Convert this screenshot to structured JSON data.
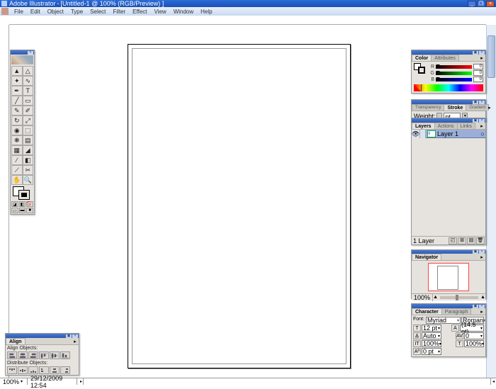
{
  "titlebar": {
    "app": "Adobe Illustrator",
    "doc": "[Untitled-1 @ 100% (RGB/Preview) ]"
  },
  "menu": [
    "File",
    "Edit",
    "Object",
    "Type",
    "Select",
    "Filter",
    "Effect",
    "View",
    "Window",
    "Help"
  ],
  "status": {
    "zoom": "100%",
    "datetime": "29/12/2009  12:54"
  },
  "color": {
    "tab_color": "Color",
    "tab_attr": "Attributes",
    "r": "0",
    "g": "0",
    "b": "0"
  },
  "stroke": {
    "tab_trans": "Transparency",
    "tab_stroke": "Stroke",
    "tab_grad": "Gradient",
    "label": "Weight:",
    "value": "",
    "unit": "pt"
  },
  "layers": {
    "tab_layers": "Layers",
    "tab_actions": "Actions",
    "tab_links": "Links",
    "row1": "Layer 1",
    "footer": "1 Layer"
  },
  "nav": {
    "tab": "Navigator",
    "zoom": "100%"
  },
  "char": {
    "tab_char": "Character",
    "tab_para": "Paragraph",
    "font_lbl": "Font:",
    "font": "Myriad",
    "style": "Roman",
    "size": "12 pt",
    "leading": "(14.5 pt)",
    "kerning": "Auto",
    "tracking": "0",
    "vscale": "100%",
    "hscale": "100%",
    "baseline": "0 pt"
  },
  "align": {
    "tab": "Align",
    "hdr1": "Align Objects:",
    "hdr2": "Distribute Objects:"
  }
}
